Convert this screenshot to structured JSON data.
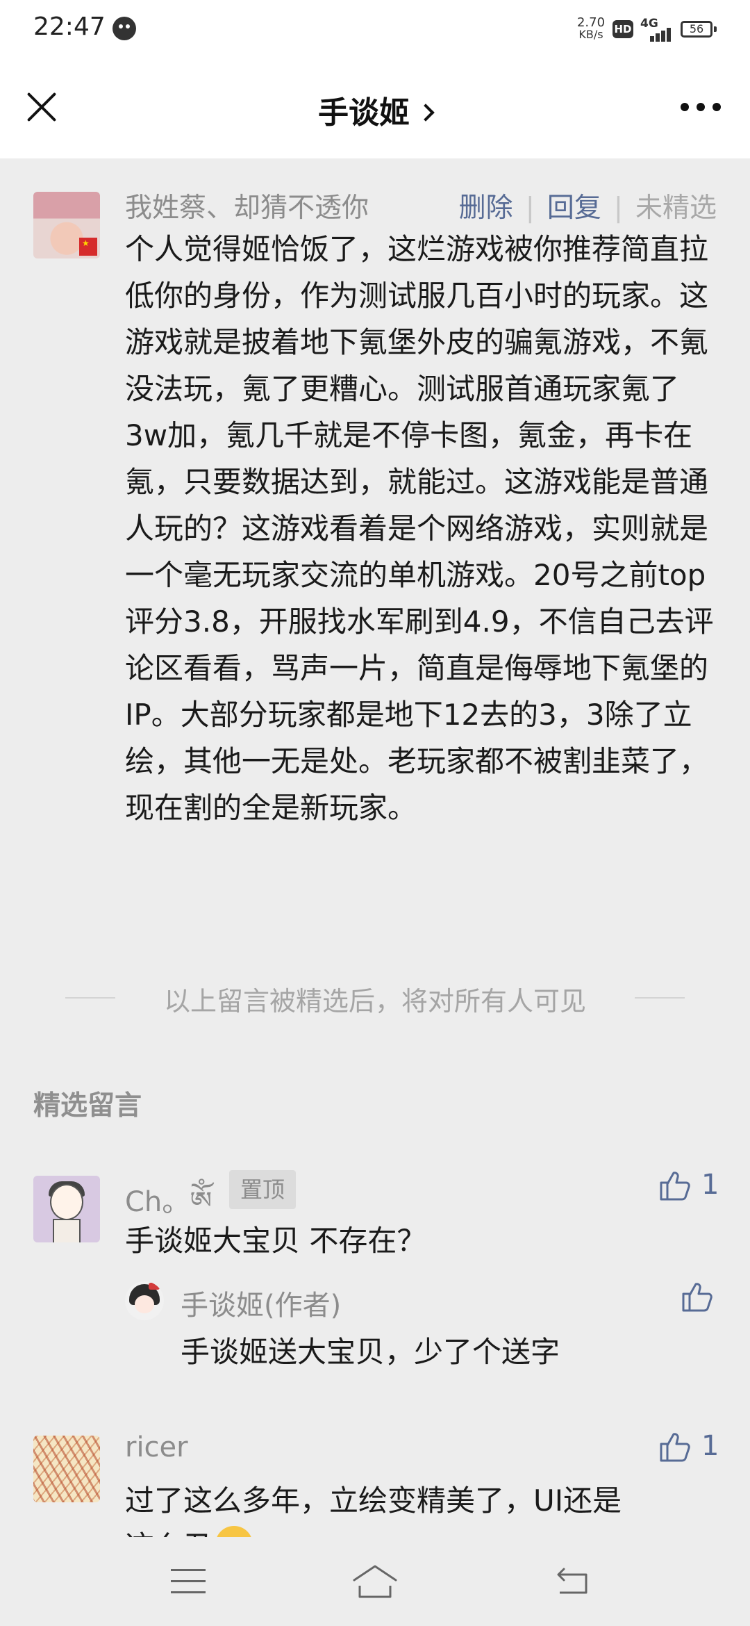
{
  "status_bar": {
    "time": "22:47",
    "net_speed_value": "2.70",
    "net_speed_unit": "KB/s",
    "hd_badge": "HD",
    "network": "4G",
    "battery": "56"
  },
  "header": {
    "title": "手谈姬",
    "close_icon": "close-icon",
    "more_icon": "more-dots-icon"
  },
  "my_comment": {
    "author": "我姓蔡、却猜不透你",
    "actions": {
      "delete": "删除",
      "reply": "回复",
      "featured_state": "未精选"
    },
    "text": "个人觉得姬恰饭了，这烂游戏被你推荐简直拉低你的身份，作为测试服几百小时的玩家。这游戏就是披着地下氪堡外皮的骗氪游戏，不氪没法玩，氪了更糟心。测试服首通玩家氪了3w加，氪几千就是不停卡图，氪金，再卡在氪，只要数据达到，就能过。这游戏能是普通人玩的？这游戏看着是个网络游戏，实则就是一个毫无玩家交流的单机游戏。20号之前top评分3.8，开服找水军刷到4.9，不信自己去评论区看看，骂声一片，简直是侮辱地下氪堡的IP。大部分玩家都是地下12去的3，3除了立绘，其他一无是处。老玩家都不被割韭菜了，现在割的全是新玩家。"
  },
  "notice": "以上留言被精选后，将对所有人可见",
  "featured_section": {
    "title": "精选留言",
    "comments": [
      {
        "author": "Ch。ༀ",
        "pinned_label": "置顶",
        "likes": "1",
        "text": "手谈姬大宝贝 不存在？",
        "reply": {
          "author": "手谈姬(作者)",
          "text": "手谈姬送大宝贝，少了个送字"
        }
      },
      {
        "author": "ricer",
        "likes": "1",
        "text": "过了这么多年，立绘变精美了，UI还是",
        "text_cut": "这么丑"
      }
    ]
  },
  "icons": {
    "like": "thumbs-up-icon",
    "nav_menu": "menu-icon",
    "nav_home": "home-icon",
    "nav_back": "back-icon"
  },
  "colors": {
    "link": "#576b95",
    "background": "#ededed",
    "muted_text": "#8c8c8c"
  }
}
